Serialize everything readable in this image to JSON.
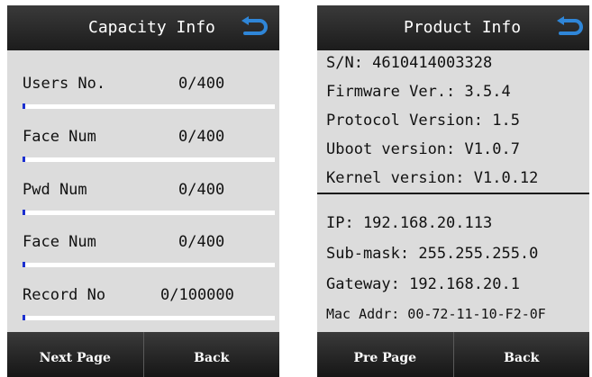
{
  "capacity": {
    "title": "Capacity Info",
    "rows": [
      {
        "label": "Users No.",
        "value": "0/400",
        "fill": 0.0
      },
      {
        "label": "Face Num",
        "value": "0/400",
        "fill": 0.0
      },
      {
        "label": "Pwd Num",
        "value": "0/400",
        "fill": 0.0
      },
      {
        "label": "Face Num",
        "value": "0/400",
        "fill": 0.0
      },
      {
        "label": "Record No",
        "value": "0/100000",
        "fill": 0.0
      }
    ],
    "buttons": {
      "next": "Next Page",
      "back": "Back"
    }
  },
  "product": {
    "title": "Product Info",
    "device_lines": [
      "S/N: 4610414003328",
      "Firmware Ver.: 3.5.4",
      "Protocol Version: 1.5",
      "Uboot version: V1.0.7",
      "Kernel version: V1.0.12"
    ],
    "network_lines": [
      "IP: 192.168.20.113",
      "Sub-mask: 255.255.255.0",
      "Gateway: 192.168.20.1",
      "Mac Addr: 00-72-11-10-F2-0F"
    ],
    "buttons": {
      "prev": "Pre Page",
      "back": "Back"
    }
  },
  "colors": {
    "header_bg": "#1c1c1c",
    "screen_bg": "#dcdcdc",
    "progress_fill": "#1b2fd0",
    "icon_accent": "#2f86d8"
  },
  "icons": {
    "back": "return-arrow-icon"
  }
}
